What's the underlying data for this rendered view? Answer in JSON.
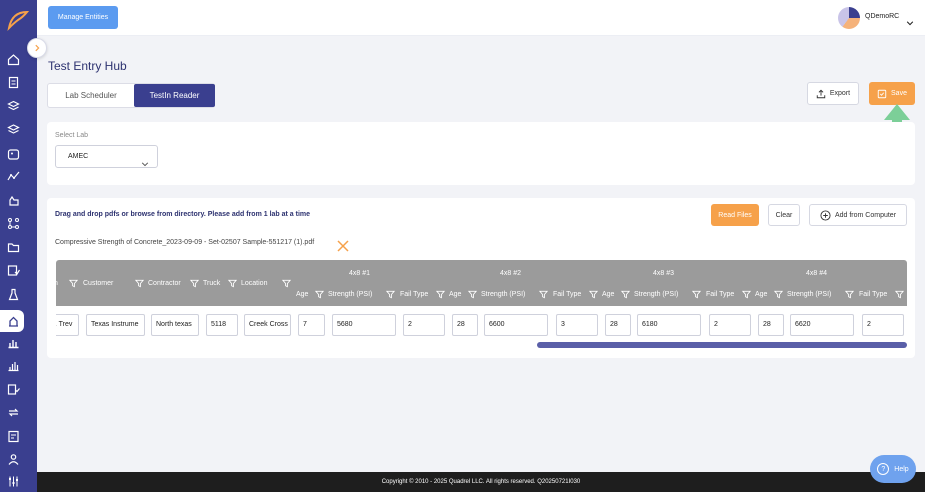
{
  "topbar": {
    "manage_entities": "Manage Entities",
    "user_name": "QDemoRC"
  },
  "page": {
    "title": "Test Entry Hub"
  },
  "tabs": [
    {
      "label": "Lab Scheduler"
    },
    {
      "label": "TestIn Reader"
    }
  ],
  "actions": {
    "export": "Export",
    "save": "Save"
  },
  "lab": {
    "label": "Select Lab",
    "selected": "AMEC"
  },
  "upload": {
    "instructions": "Drag and drop pdfs or browse from directory. Please add from 1 lab at a time",
    "read_files": "Read Files",
    "clear": "Clear",
    "add_from_computer": "Add from Computer",
    "file_name": "Compressive Strength of Concrete_2023-09-09 - Set-02507 Sample-551217 (1).pdf"
  },
  "table": {
    "headers": {
      "n": "n",
      "customer": "Customer",
      "contractor": "Contractor",
      "truck": "Truck",
      "location": "Location",
      "age": "Age",
      "strength": "Strength (PSI)",
      "fail_type": "Fail Type"
    },
    "groups": [
      "4x8 #1",
      "4x8 #2",
      "4x8 #3",
      "4x8 #4"
    ],
    "row": {
      "n": "n. Trev",
      "customer": "Texas Instrume",
      "contractor": "North texas",
      "truck": "5118",
      "location": "Creek Cross",
      "s1": {
        "age": "7",
        "strength": "5680",
        "fail": "2"
      },
      "s2": {
        "age": "28",
        "strength": "6600",
        "fail": "3"
      },
      "s3": {
        "age": "28",
        "strength": "6180",
        "fail": "2"
      },
      "s4": {
        "age": "28",
        "strength": "6620",
        "fail": "2"
      }
    }
  },
  "footer": {
    "text": "Copyright © 2010 - 2025 Quadrel LLC. All rights reserved. Q20250721I030"
  },
  "help": {
    "label": "Help"
  },
  "colors": {
    "sidebar": "#3a3f8f",
    "accent_orange": "#f6a14a",
    "arrow_green": "#7ccf98",
    "header_grey": "#9b9b9b"
  },
  "icons": [
    "logo-icon",
    "home-icon",
    "document-icon",
    "layers-plus-icon",
    "layers-icon",
    "image-icon",
    "graph-icon",
    "hand-icon",
    "network-icon",
    "folder-icon",
    "check-doc-icon",
    "flask-icon",
    "lab-icon",
    "bar-chart-icon",
    "column-chart-icon",
    "list-check-icon",
    "repeat-icon",
    "report-icon",
    "person-icon",
    "settings-sliders-icon"
  ]
}
